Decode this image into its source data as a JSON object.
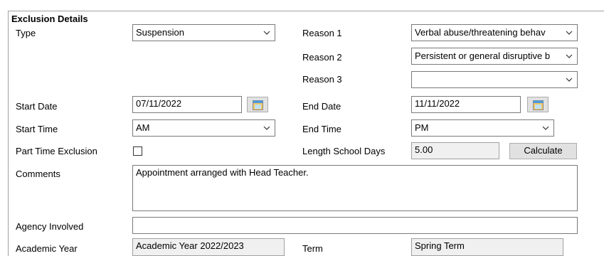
{
  "section": {
    "title": "Exclusion Details"
  },
  "labels": {
    "type": "Type",
    "reason1": "Reason 1",
    "reason2": "Reason 2",
    "reason3": "Reason 3",
    "start_date": "Start Date",
    "end_date": "End Date",
    "start_time": "Start Time",
    "end_time": "End Time",
    "part_time": "Part Time Exclusion",
    "length": "Length School Days",
    "comments": "Comments",
    "agency": "Agency Involved",
    "academic_year": "Academic Year",
    "term": "Term"
  },
  "values": {
    "type": "Suspension",
    "reason1": "Verbal abuse/threatening behav",
    "reason2": "Persistent or general disruptive b",
    "reason3": "",
    "start_date": "07/11/2022",
    "end_date": "11/11/2022",
    "start_time": "AM",
    "end_time": "PM",
    "part_time_checked": false,
    "length": "5.00",
    "comments": "Appointment arranged with Head Teacher.",
    "agency": "",
    "academic_year": "Academic Year 2022/2023",
    "term": "Spring Term"
  },
  "buttons": {
    "calculate": "Calculate"
  },
  "icons": {
    "calendar": "calendar-icon",
    "dropdown": "chevron-down-icon"
  },
  "colors": {
    "border": "#7a7a7a",
    "readonly_bg": "#f0f0f0",
    "button_bg": "#e1e1e1"
  }
}
